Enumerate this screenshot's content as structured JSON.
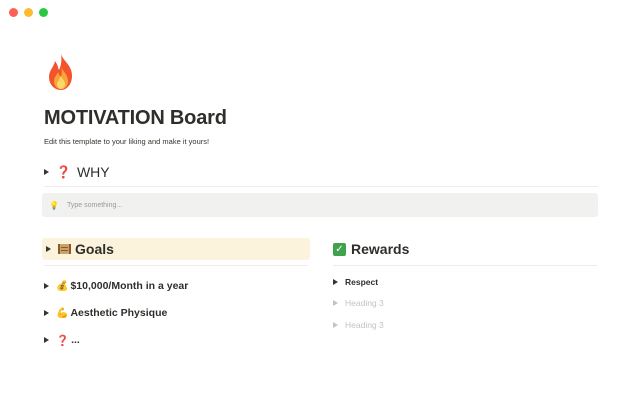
{
  "window": {
    "traffic_lights": [
      {
        "name": "close",
        "color": "#ff5f57"
      },
      {
        "name": "minimize",
        "color": "#febc2e"
      },
      {
        "name": "zoom",
        "color": "#28c840"
      }
    ]
  },
  "page": {
    "icon": "fire-icon",
    "title": "MOTIVATION Board",
    "subtitle": "Edit this template to your liking and make it yours!"
  },
  "why": {
    "label": "WHY",
    "icon": "red-question-mark-icon",
    "icon_glyph": "❓"
  },
  "callout": {
    "icon": "lightbulb-icon",
    "icon_glyph": "💡",
    "placeholder": "Type something..."
  },
  "goals": {
    "heading": "Goals",
    "icon": "scroll-icon",
    "highlight_color": "#fbf3db",
    "items": [
      {
        "icon": "money-bag-icon",
        "icon_glyph": "💰",
        "label": "$10,000/Month in a year"
      },
      {
        "icon": "flexed-biceps-icon",
        "icon_glyph": "💪",
        "label": "Aesthetic Physique"
      },
      {
        "icon": "red-question-mark-icon",
        "icon_glyph": "❓",
        "label": "..."
      }
    ]
  },
  "rewards": {
    "heading": "Rewards",
    "icon": "check-mark-button-icon",
    "icon_glyph": "✓",
    "items": [
      {
        "label": "Respect",
        "placeholder": false
      },
      {
        "label": "Heading 3",
        "placeholder": true
      },
      {
        "label": "Heading 3",
        "placeholder": true
      }
    ]
  }
}
